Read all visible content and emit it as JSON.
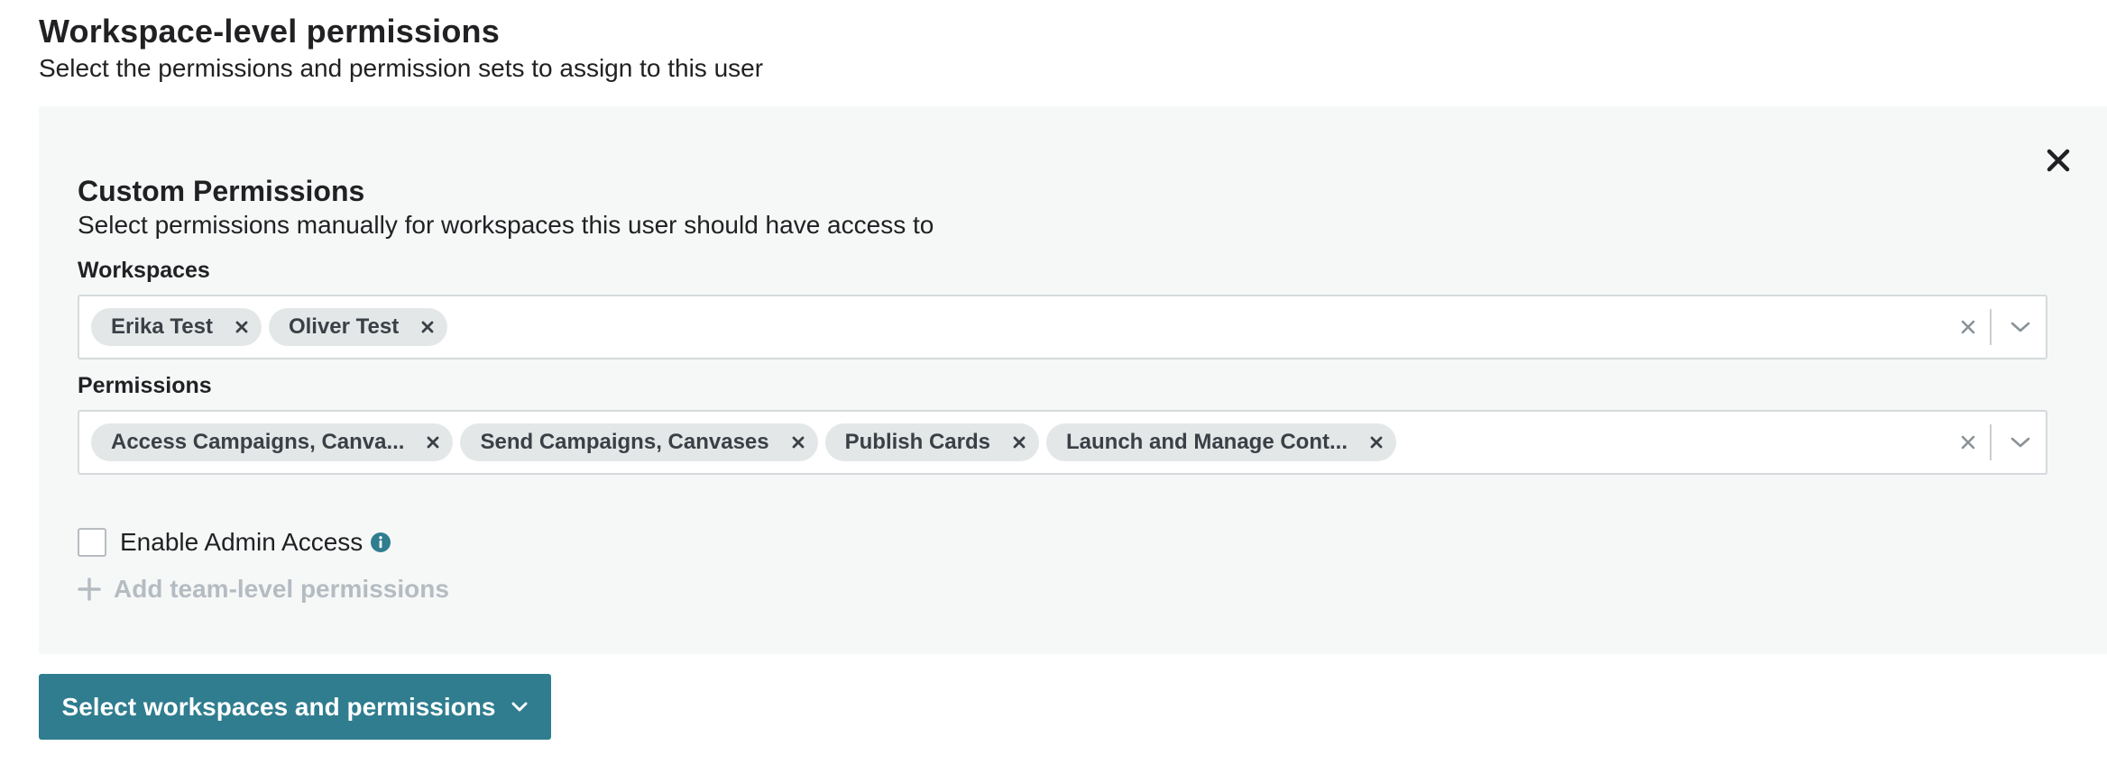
{
  "header": {
    "title": "Workspace-level permissions",
    "subtitle": "Select the permissions and permission sets to assign to this user"
  },
  "panel": {
    "title": "Custom Permissions",
    "subtitle": "Select permissions manually for workspaces this user should have access to",
    "close_icon": "close-icon",
    "background": "#f6f8f8"
  },
  "workspaces": {
    "label": "Workspaces",
    "selected": [
      "Erika Test",
      "Oliver Test"
    ]
  },
  "permissions": {
    "label": "Permissions",
    "selected": [
      "Access Campaigns, Canva...",
      "Send Campaigns, Canvases",
      "Publish Cards",
      "Launch and Manage Cont..."
    ]
  },
  "admin_access": {
    "label": "Enable Admin Access",
    "checked": false,
    "info_icon": "info-icon"
  },
  "add_team": {
    "label": "Add team-level permissions",
    "icon": "plus-icon",
    "enabled": false
  },
  "primary_button": {
    "label": "Select workspaces and permissions",
    "icon": "chevron-down-icon",
    "color": "#2f7d8f"
  },
  "colors": {
    "chip_bg": "#e4e7e8",
    "info_icon": "#2f7d8f",
    "disabled_text": "#b5bcc1"
  }
}
